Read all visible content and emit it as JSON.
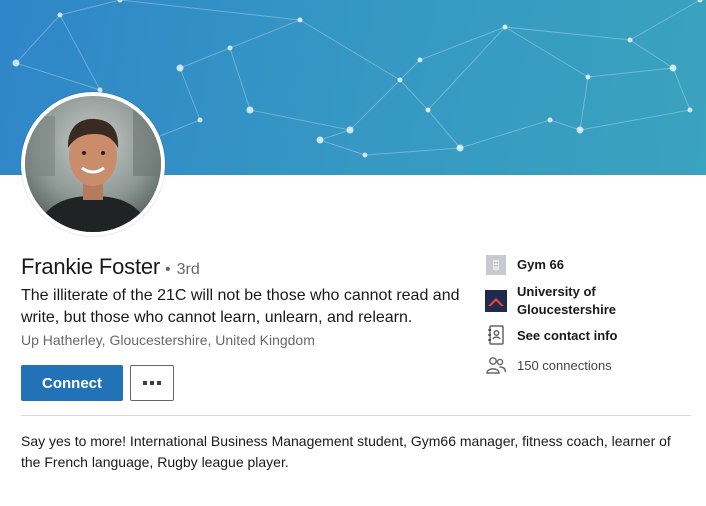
{
  "profile": {
    "name": "Frankie Foster",
    "degree_dot": "•",
    "degree": "3rd",
    "headline": "The illiterate of the 21C will not be those who cannot read and write, but those who cannot learn, unlearn, and relearn.",
    "location": "Up Hatherley, Gloucestershire, United Kingdom",
    "summary": "Say yes to more! International Business Management student, Gym66 manager, fitness coach, learner of the French language, Rugby league player."
  },
  "actions": {
    "connect_label": "Connect",
    "more_icon": "ellipsis-icon"
  },
  "sidebar": {
    "company": {
      "label": "Gym 66",
      "icon": "company-placeholder-icon"
    },
    "school": {
      "label": "University of Gloucestershire",
      "line1": "University of",
      "line2": "Gloucestershire",
      "icon": "university-logo-icon"
    },
    "contact": {
      "label": "See contact info",
      "icon": "contact-card-icon"
    },
    "connections": {
      "label": "150 connections",
      "icon": "people-icon"
    }
  },
  "colors": {
    "primary_button": "#2272b8",
    "banner_start": "#2f86c8",
    "banner_end": "#3aa3be",
    "university_red": "#e4463c",
    "university_navy": "#1f2b4d"
  }
}
